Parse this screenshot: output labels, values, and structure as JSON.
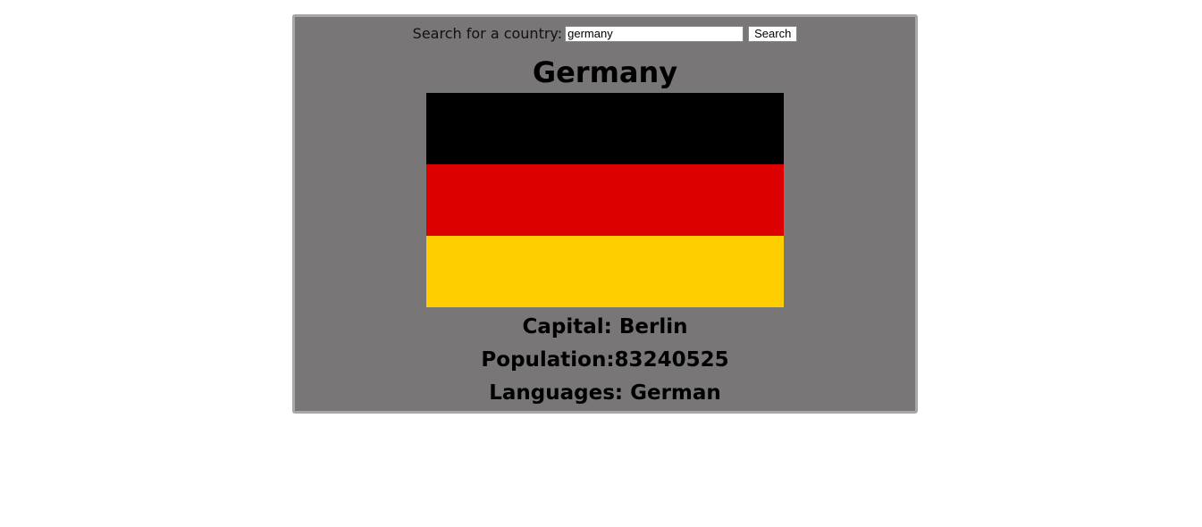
{
  "search": {
    "label": "Search for a country:",
    "input_value": "germany",
    "button_label": "Search"
  },
  "country": {
    "name": "Germany",
    "flag": {
      "stripes": [
        "#000000",
        "#dd0000",
        "#ffce00"
      ]
    },
    "capital_text": "Capital: Berlin",
    "population_text": "Population:83240525",
    "languages_text": "Languages: German"
  }
}
